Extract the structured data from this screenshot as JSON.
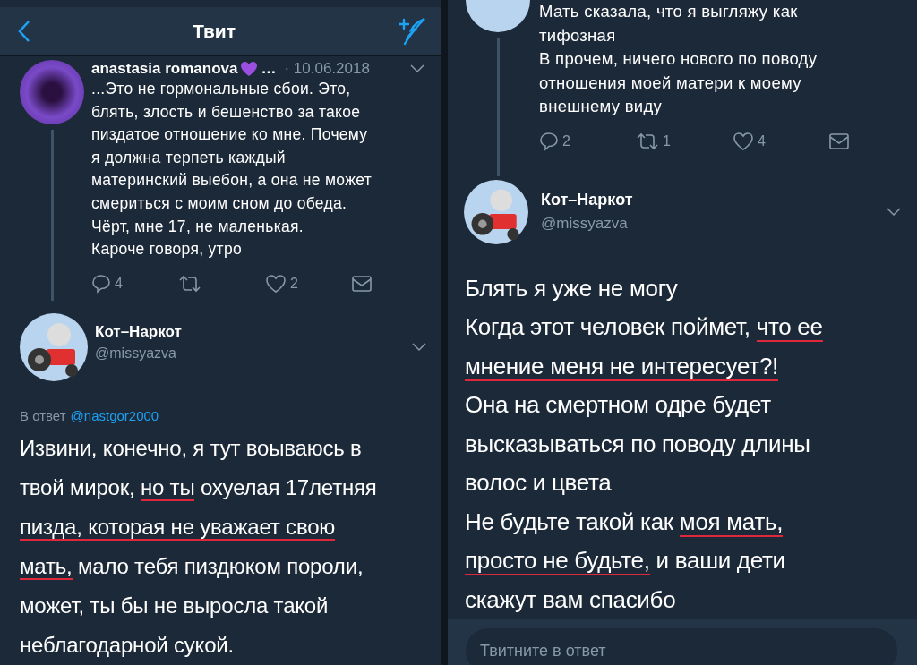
{
  "left_screen": {
    "nav": {
      "title": "Твит"
    },
    "parent_tweet": {
      "name": "anastasia romanova",
      "name_suffix": "…",
      "date": "· 10.06.2018",
      "lines": [
        [
          {
            "text": "...Это не гормональные сбои. Это,",
            "underlined": false
          }
        ],
        [
          {
            "text": "блять, злость и бешенство за такое",
            "underlined": false
          }
        ],
        [
          {
            "text": "пиздатое отношение ко мне. Почему",
            "underlined": false
          }
        ],
        [
          {
            "text": "я должна терпеть каждый",
            "underlined": false
          }
        ],
        [
          {
            "text": "материнский выебон, а она не может",
            "underlined": false
          }
        ],
        [
          {
            "text": "смериться  с моим сном до обеда.",
            "underlined": false
          }
        ],
        [
          {
            "text": "Чёрт, мне 17, не маленькая.",
            "underlined": false
          }
        ],
        [
          {
            "text": "Кароче говоря, утро",
            "underlined": false
          }
        ]
      ],
      "actions": {
        "replies": "4",
        "likes": "2"
      }
    },
    "reply_tweet": {
      "name": "Кот–Наркот",
      "handle": "@missyazva",
      "reply_label": "В ответ",
      "reply_to": "@nastgor2000",
      "lines": [
        [
          {
            "text": "Извини, конечно, я тут воываюсь в",
            "underlined": false
          }
        ],
        [
          {
            "text": "твой мирок, ",
            "underlined": false
          },
          {
            "text": "но ты",
            "underlined": true
          },
          {
            "text": " охуелая 17летняя",
            "underlined": false
          }
        ],
        [
          {
            "text": "пизда, которая не уважает свою",
            "underlined": true
          }
        ],
        [
          {
            "text": "мать,",
            "underlined": true
          },
          {
            "text": " мало тебя пиздюком пороли,",
            "underlined": false
          }
        ],
        [
          {
            "text": "может, ты бы не выросла такой",
            "underlined": false
          }
        ],
        [
          {
            "text": "неблагодарной сукой.",
            "underlined": false
          }
        ]
      ]
    }
  },
  "right_screen": {
    "parent_tweet": {
      "lines": [
        [
          {
            "text": "Мать сказала, что я выгляжу как",
            "underlined": false
          }
        ],
        [
          {
            "text": "тифозная",
            "underlined": false
          }
        ],
        [
          {
            "text": "В прочем, ничего нового по поводу",
            "underlined": false
          }
        ],
        [
          {
            "text": "отношения моей матери к моему",
            "underlined": false
          }
        ],
        [
          {
            "text": "внешнему виду",
            "underlined": false
          }
        ]
      ],
      "actions": {
        "replies": "2",
        "retweets": "1",
        "likes": "4"
      }
    },
    "reply_tweet": {
      "name": "Кот–Наркот",
      "handle": "@missyazva",
      "lines": [
        [
          {
            "text": "Блять я уже не могу",
            "underlined": false
          }
        ],
        [
          {
            "text": "Когда этот человек поймет, ",
            "underlined": false
          },
          {
            "text": "что ее",
            "underlined": true
          }
        ],
        [
          {
            "text": "мнение меня не интересует?!",
            "underlined": true
          }
        ],
        [
          {
            "text": "Она на смертном одре будет",
            "underlined": false
          }
        ],
        [
          {
            "text": "высказываться по поводу длины",
            "underlined": false
          }
        ],
        [
          {
            "text": "волос и цвета",
            "underlined": false
          }
        ],
        [
          {
            "text": "Не будьте такой как ",
            "underlined": false
          },
          {
            "text": "моя мать,",
            "underlined": true
          }
        ],
        [
          {
            "text": "просто не будьте,",
            "underlined": true
          },
          {
            "text": " и ваши дети",
            "underlined": false
          }
        ],
        [
          {
            "text": "скажут вам спасибо",
            "underlined": false
          }
        ]
      ]
    },
    "reply_field": {
      "placeholder": "Твитните в ответ"
    }
  }
}
